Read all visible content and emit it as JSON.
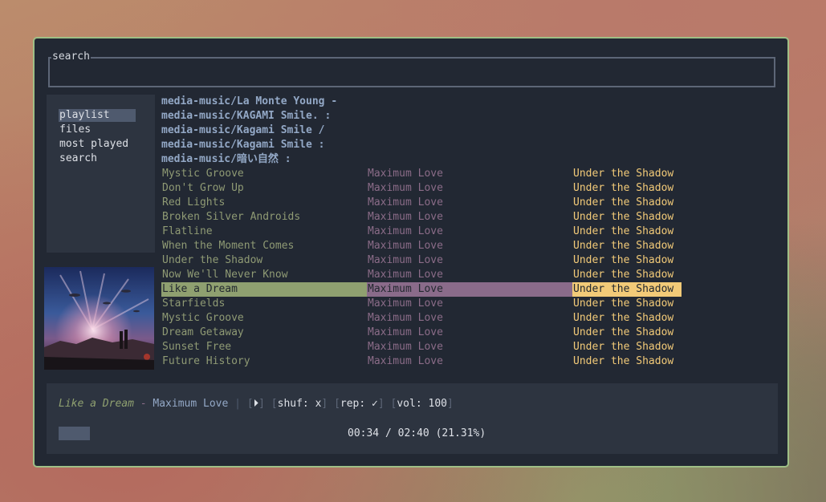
{
  "search": {
    "title": "search",
    "value": ""
  },
  "sidebar": {
    "items": [
      {
        "label": "playlist",
        "active": true
      },
      {
        "label": "files",
        "active": false
      },
      {
        "label": "most played",
        "active": false
      },
      {
        "label": "search",
        "active": false
      }
    ]
  },
  "directories": [
    "media-music/La Monte Young -",
    "media-music/KAGAMI Smile. :",
    "media-music/Kagami Smile /",
    "media-music/Kagami Smile :",
    "media-music/暗い自然 :"
  ],
  "tracks": [
    {
      "title": "Mystic Groove",
      "album": "Maximum Love",
      "artist": "Under the Shadow"
    },
    {
      "title": "Don't Grow Up",
      "album": "Maximum Love",
      "artist": "Under the Shadow"
    },
    {
      "title": "Red Lights",
      "album": "Maximum Love",
      "artist": "Under the Shadow"
    },
    {
      "title": "Broken Silver Androids",
      "album": "Maximum Love",
      "artist": "Under the Shadow"
    },
    {
      "title": "Flatline",
      "album": "Maximum Love",
      "artist": "Under the Shadow"
    },
    {
      "title": "When the Moment Comes",
      "album": "Maximum Love",
      "artist": "Under the Shadow"
    },
    {
      "title": "Under the Shadow",
      "album": "Maximum Love",
      "artist": "Under the Shadow"
    },
    {
      "title": "Now We'll Never Know",
      "album": "Maximum Love",
      "artist": "Under the Shadow"
    },
    {
      "title": "Like a Dream",
      "album": "Maximum Love",
      "artist": "Under the Shadow",
      "current": true
    },
    {
      "title": "Starfields",
      "album": "Maximum Love",
      "artist": "Under the Shadow"
    },
    {
      "title": "Mystic Groove",
      "album": "Maximum Love",
      "artist": "Under the Shadow"
    },
    {
      "title": "Dream Getaway",
      "album": "Maximum Love",
      "artist": "Under the Shadow"
    },
    {
      "title": "Sunset Free",
      "album": "Maximum Love",
      "artist": "Under the Shadow"
    },
    {
      "title": "Future History",
      "album": "Maximum Love",
      "artist": "Under the Shadow"
    }
  ],
  "player": {
    "title": "Like a Dream",
    "dash": " - ",
    "album": "Maximum Love",
    "separator": "|",
    "play_icon": "play-icon",
    "shuffle_label": "shuf:",
    "shuffle_value": "x",
    "repeat_label": "rep:",
    "repeat_value": "✓",
    "volume_label": "vol:",
    "volume_value": "100",
    "elapsed": "00:34",
    "total": "02:40",
    "time_text": "00:34 / 02:40 (21.31%)",
    "progress": 0.2131
  },
  "colors": {
    "background": "#222833",
    "border": "#9fbf86",
    "panel": "#2d3440",
    "title": "#8f9a74",
    "album": "#8b6c88",
    "artist": "#f2ca78",
    "directory": "#93a8c6",
    "selection": "#4f5a6e"
  },
  "album_art": "album-cover-image"
}
